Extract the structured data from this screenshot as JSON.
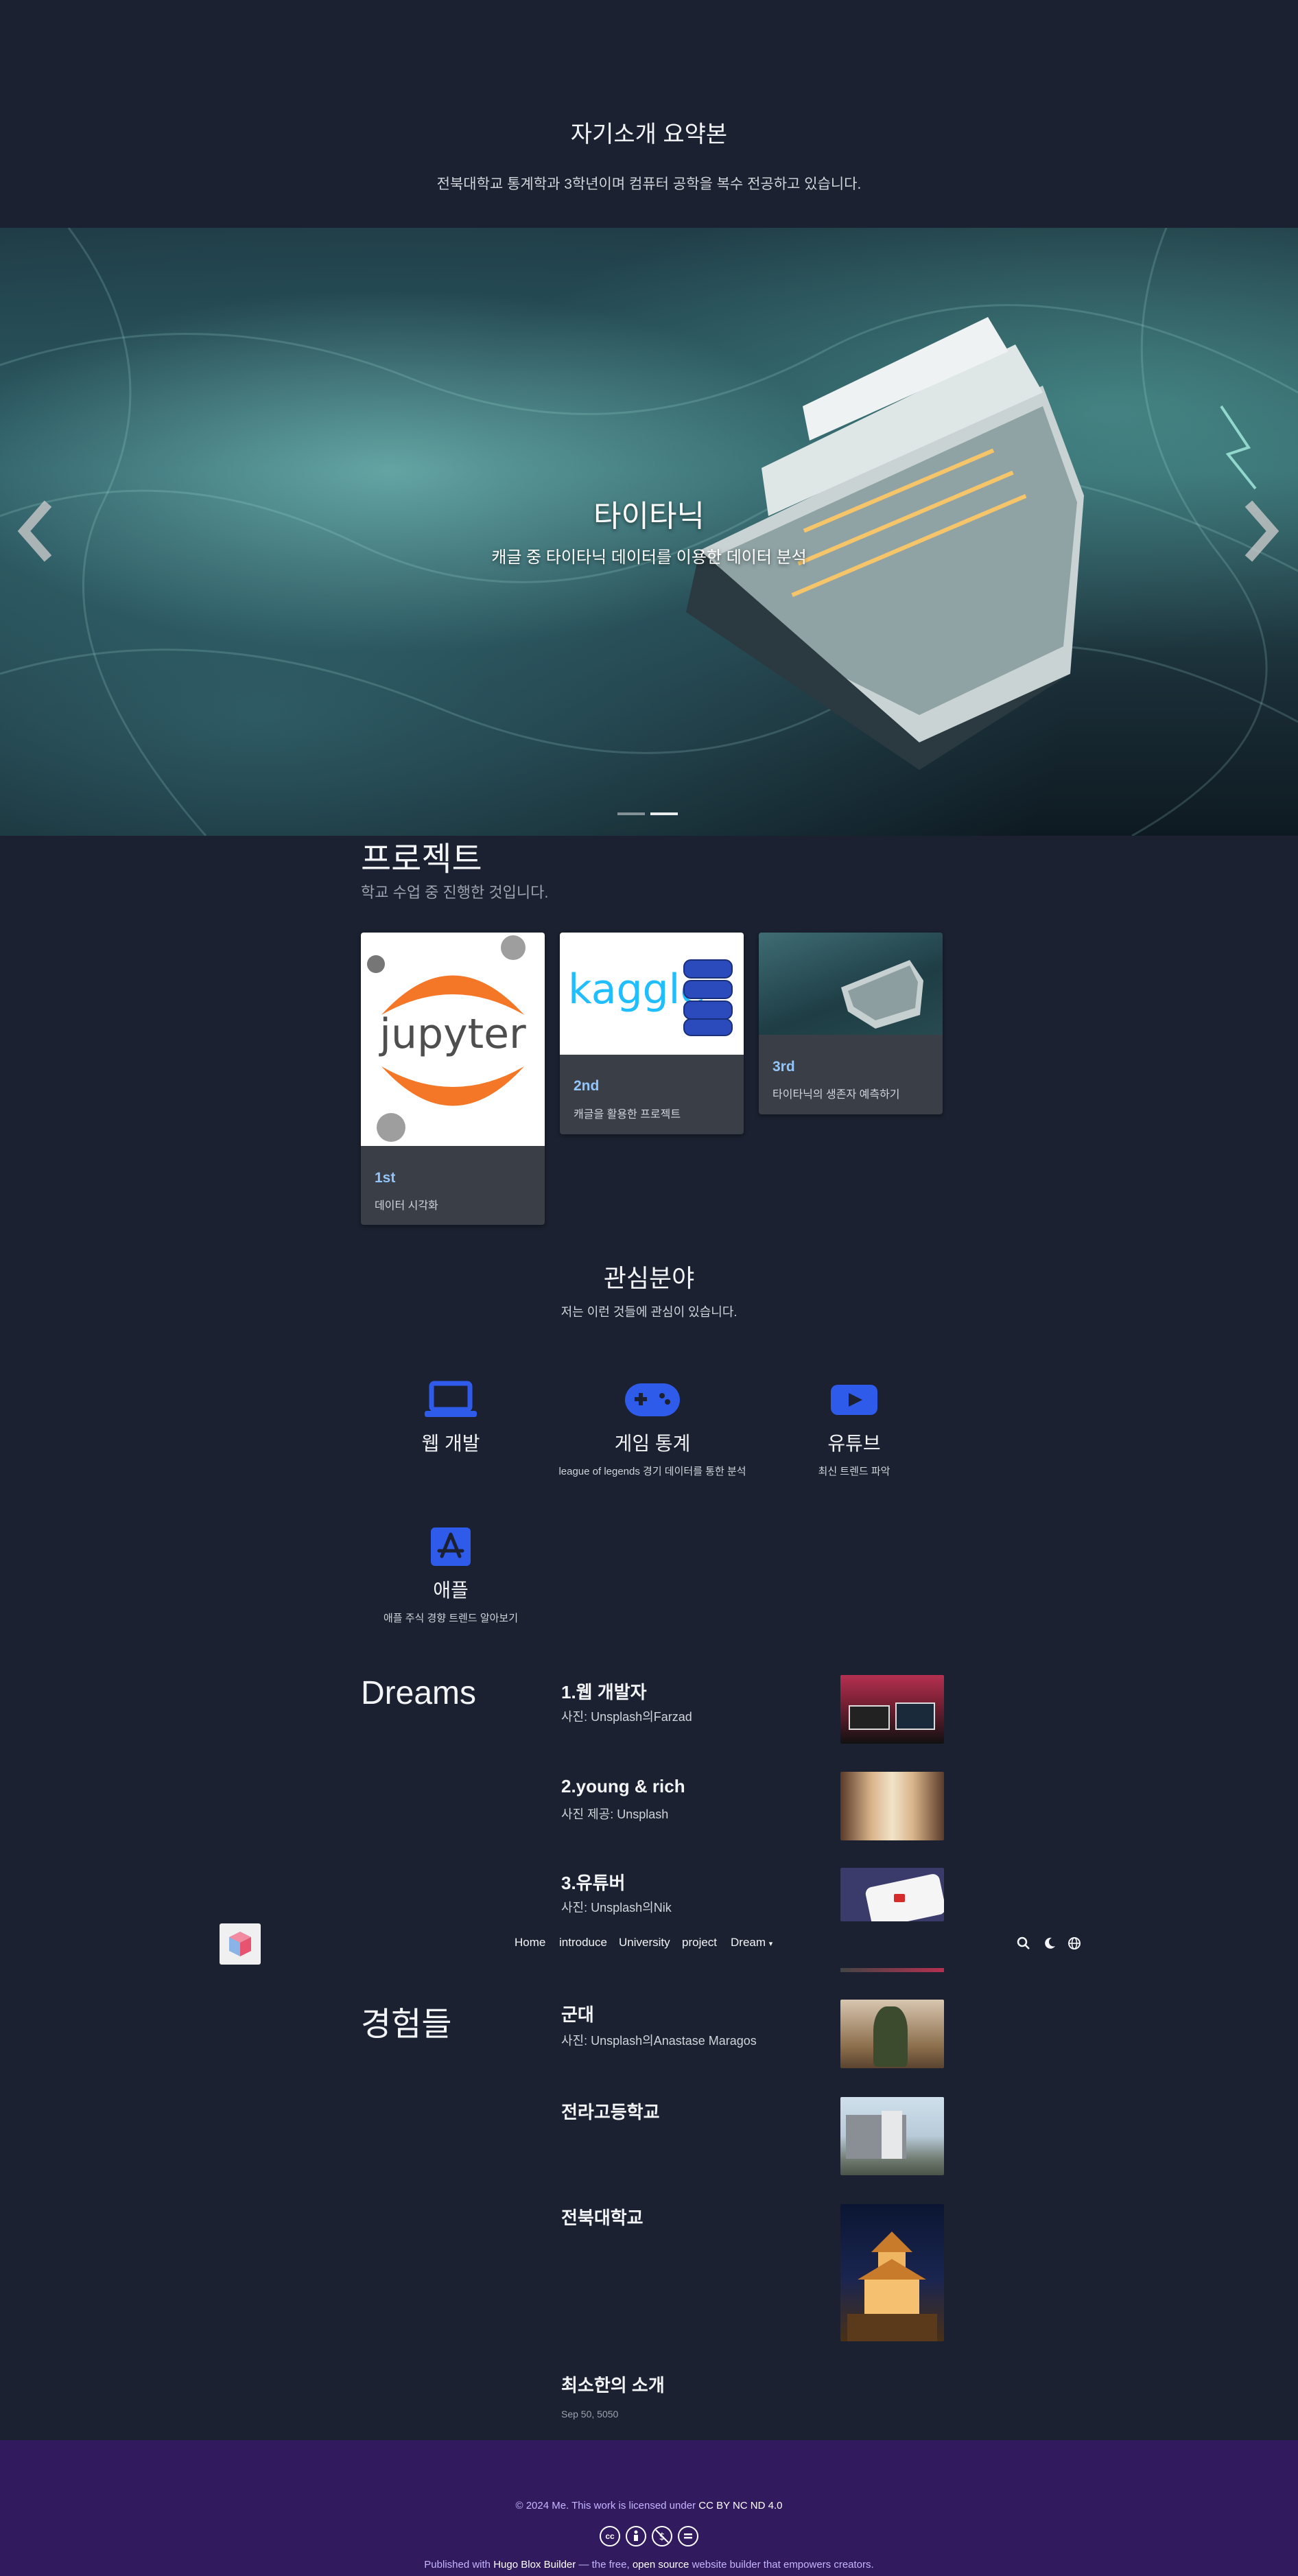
{
  "hero": {
    "title": "자기소개 요약본",
    "subtitle": "전북대학교 통계학과 3학년이며 컴퓨터 공학을 복수 전공하고 있습니다."
  },
  "carousel": {
    "title": "타이타닉",
    "subtitle": "캐글 중 타이타닉 데이터를 이용한 데이터 분석",
    "prev_icon": "chevron-left-icon",
    "next_icon": "chevron-right-icon"
  },
  "projects": {
    "title": "프로젝트",
    "subtitle": "학교 수업 중 진행한 것입니다.",
    "cards": [
      {
        "label": "1st",
        "desc": "데이터 시각화",
        "image": "jupyter-logo"
      },
      {
        "label": "2nd",
        "desc": "캐글을 활용한 프로젝트",
        "image": "kaggle-logo",
        "logo_text": "kaggle"
      },
      {
        "label": "3rd",
        "desc": "타이타닉의 생존자 예측하기",
        "image": "titanic-ship"
      }
    ]
  },
  "interests": {
    "title": "관심분야",
    "subtitle": "저는 이런 것들에 관심이 있습니다.",
    "items": [
      {
        "name": "웹 개발",
        "desc": "",
        "icon": "laptop-icon"
      },
      {
        "name": "게임 통계",
        "desc": "league of legends 경기 데이터를 통한 분석",
        "icon": "gamepad-icon"
      },
      {
        "name": "유튜브",
        "desc": "최신 트렌드 파악",
        "icon": "youtube-icon"
      },
      {
        "name": "애플",
        "desc": "애플 주식 경향 트렌드 알아보기",
        "icon": "app-store-icon"
      }
    ]
  },
  "dreams": {
    "title": "Dreams",
    "items": [
      {
        "title": "1.웹 개발자",
        "caption": "사진: Unsplash의Farzad"
      },
      {
        "title": "2.young & rich",
        "caption": "사진 제공: Unsplash"
      },
      {
        "title": "3.유튜버",
        "caption": "사진: Unsplash의Nik"
      }
    ]
  },
  "navbar": {
    "links": [
      "Home",
      "introduce",
      "University",
      "project",
      "Dream"
    ],
    "icons": [
      "search-icon",
      "moon-icon",
      "globe-icon"
    ]
  },
  "experience": {
    "title": "경험들",
    "items": [
      {
        "title": "군대",
        "caption": "사진: Unsplash의Anastase Maragos"
      },
      {
        "title": "전라고등학교",
        "caption": ""
      },
      {
        "title": "전북대학교",
        "caption": ""
      },
      {
        "title": "최소한의 소개",
        "caption": "Sep 50, 5050"
      }
    ]
  },
  "footer": {
    "license_prefix": "© 2024 Me. This work is licensed under",
    "license_link": "CC BY NC ND 4.0",
    "published_prefix": "Published with",
    "builder_link": "Hugo Blox Builder",
    "published_mid": "— the free,",
    "open_source_link": "open source",
    "published_suffix": "website builder that empowers creators."
  },
  "colors": {
    "background": "#1b2130",
    "accent_blue": "#2f5bea",
    "footer_bg": "#311b5e",
    "card_label": "#93c5fd"
  }
}
